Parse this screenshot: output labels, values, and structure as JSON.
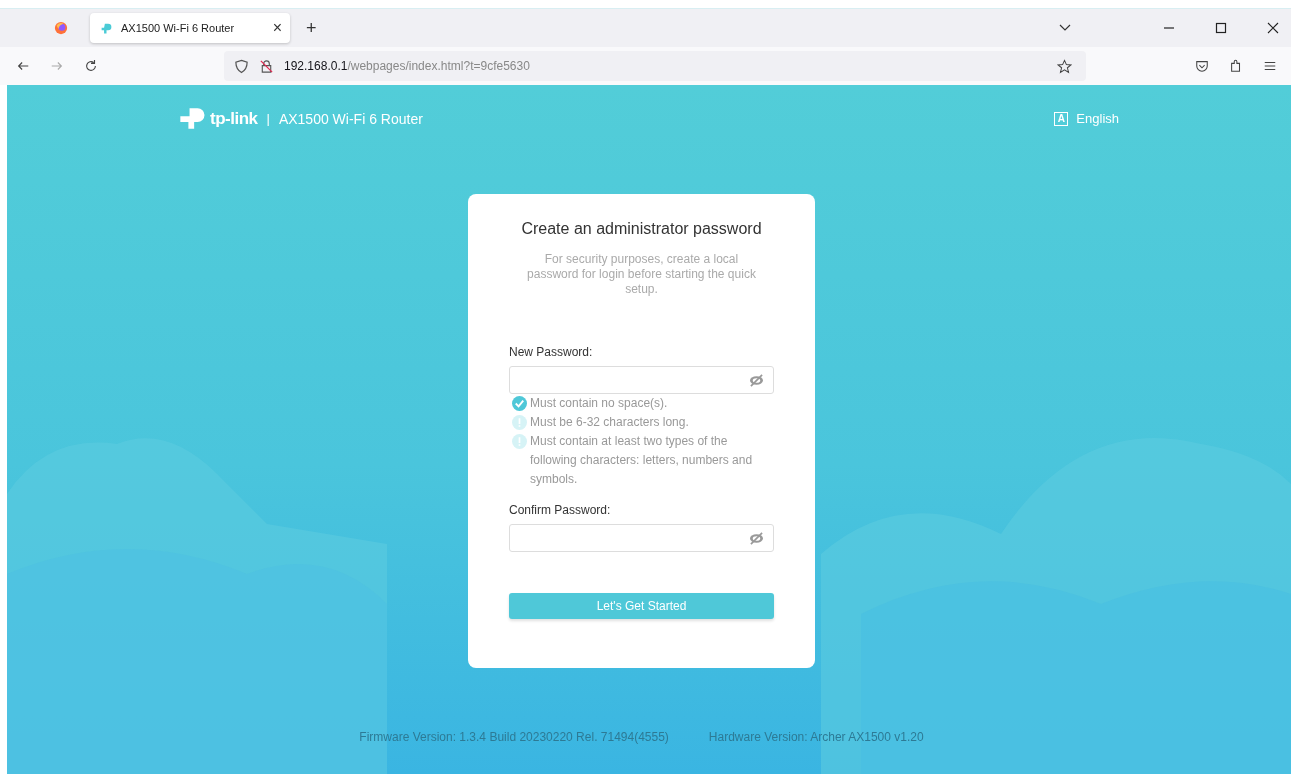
{
  "browser": {
    "tabs": [
      {
        "title": "AX1500 Wi-Fi 6 Router",
        "close": "×",
        "selected": true
      }
    ],
    "new_tab": "+",
    "url_host": "192.168.0.1",
    "url_path": "/webpages/index.html?t=9cfe5630"
  },
  "header": {
    "brand": "tp-link",
    "separator": "|",
    "product": "AX1500 Wi-Fi 6 Router",
    "language_icon": "A",
    "language": "English"
  },
  "card": {
    "title": "Create an administrator password",
    "description": "For security purposes, create a local password for login before starting the quick setup.",
    "fields": [
      {
        "label": "New Password:"
      },
      {
        "label": "Confirm Password:"
      }
    ],
    "rules": [
      {
        "text": "Must contain no space(s).",
        "met": true
      },
      {
        "text": "Must be 6-32 characters long.",
        "met": false
      },
      {
        "text": "Must contain at least two types of the following characters: letters, numbers and symbols.",
        "met": false
      }
    ],
    "button": "Let's Get Started"
  },
  "footer": {
    "firmware": "Firmware Version: 1.3.4 Build 20230220 Rel. 71494(4555)",
    "hardware": "Hardware Version: Archer AX1500 v1.20"
  }
}
